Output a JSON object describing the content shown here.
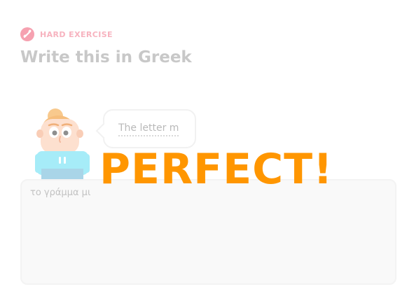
{
  "header": {
    "badge_icon": "hard-exercise-icon",
    "badge_label": "HARD EXERCISE",
    "title": "Write this in Greek"
  },
  "prompt": {
    "speaker_icon": "character-avatar-icon",
    "text": "The letter m"
  },
  "answer": {
    "value": "το γράμμα μι"
  },
  "feedback": {
    "label": "PERFECT!"
  },
  "colors": {
    "badge": "#f7b3bf",
    "title": "#c8c8c8",
    "feedback": "#ff9600",
    "answer_bg": "#f9f9f9"
  }
}
